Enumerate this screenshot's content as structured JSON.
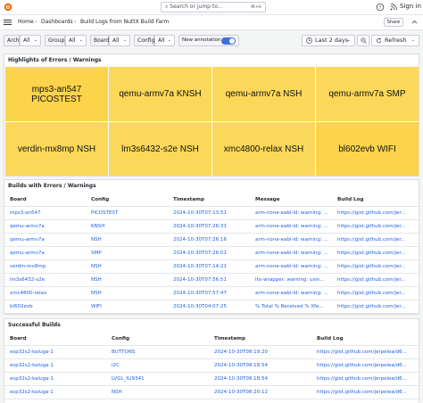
{
  "topbar": {
    "search_placeholder": "Search or jump to...",
    "search_shortcut": "⌘+k",
    "sign_in": "Sign in",
    "icons": [
      "grafana-logo-icon",
      "help-icon",
      "rss-icon",
      "user-icon"
    ]
  },
  "breadcrumb": {
    "items": [
      "Home",
      "Dashboards",
      "Build Logs from NuttX Build Farm"
    ],
    "separator": "›",
    "share": "Share"
  },
  "variables": [
    {
      "label": "Arch",
      "value": "All"
    },
    {
      "label": "Group",
      "value": "All"
    },
    {
      "label": "Board",
      "value": "All"
    },
    {
      "label": "Config",
      "value": "All"
    }
  ],
  "annotation": {
    "label": "New annotation",
    "enabled": true
  },
  "time_range": {
    "label": "Last 2 days"
  },
  "refresh": {
    "label": "Refresh"
  },
  "colors": {
    "stat_bg": "#fbd44c",
    "stat_bg_light": "#fcd85a",
    "link": "#1f62e0",
    "toggle": "#3d71d9"
  },
  "highlights": {
    "title": "Highlights of Errors / Warnings",
    "tiles": [
      "mps3-an547 PICOSTEST",
      "qemu-armv7a KNSH",
      "qemu-armv7a NSH",
      "qemu-armv7a SMP",
      "verdin-mx8mp NSH",
      "lm3s6432-s2e NSH",
      "xmc4800-relax NSH",
      "bl602evb WIFI"
    ]
  },
  "errors": {
    "title": "Builds with Errors / Warnings",
    "columns": [
      "Board",
      "Config",
      "Timestamp",
      "Message",
      "Build Log"
    ],
    "rows": [
      [
        "mps3-an547",
        "PICOSTEST",
        "2024-10-30T07:13:51",
        "arm-none-eabi-ld: warning: ...",
        "https://gist.github.com/jer..."
      ],
      [
        "qemu-armv7a",
        "KNSH",
        "2024-10-30T07:26:31",
        "arm-none-eabi-ld: warning: ...",
        "https://gist.github.com/jer..."
      ],
      [
        "qemu-armv7a",
        "NSH",
        "2024-10-30T07:26:16",
        "arm-none-eabi-ld: warning: ...",
        "https://gist.github.com/jer..."
      ],
      [
        "qemu-armv7a",
        "SMP",
        "2024-10-30T07:26:01",
        "arm-none-eabi-ld: warning: ...",
        "https://gist.github.com/jer..."
      ],
      [
        "verdin-mx8mp",
        "NSH",
        "2024-10-30T07:14:21",
        "arm-none-eabi-ld: warning: ...",
        "https://gist.github.com/jer..."
      ],
      [
        "lm3s6432-s2e",
        "NSH",
        "2024-10-30T07:56:51",
        "lto-wrapper: warning: usin...",
        "https://gist.github.com/jer..."
      ],
      [
        "xmc4800-relax",
        "NSH",
        "2024-10-30T07:57:47",
        "arm-none-eabi-ld: warning: ...",
        "https://gist.github.com/jer..."
      ],
      [
        "bl602evb",
        "WIFI",
        "2024-10-30T04:07:25",
        "% Total % Received % Xfe...",
        "https://gist.github.com/jer..."
      ]
    ]
  },
  "successful": {
    "title": "Successful Builds",
    "columns": [
      "Board",
      "Config",
      "Timestamp",
      "Build Log"
    ],
    "rows": [
      [
        "esp32s2-kaluga-1",
        "BUTTONS",
        "2024-10-30T08:19:20",
        "https://gist.github.com/jerpelea/d6..."
      ],
      [
        "esp32s2-kaluga-1",
        "I2C",
        "2024-10-30T08:18:54",
        "https://gist.github.com/jerpelea/d6..."
      ],
      [
        "esp32s2-kaluga-1",
        "LVGL_ILI9341",
        "2024-10-30T08:18:54",
        "https://gist.github.com/jerpelea/d6..."
      ],
      [
        "esp32s2-kaluga-1",
        "NSH",
        "2024-10-30T08:20:12",
        "https://gist.github.com/jerpelea/d6..."
      ]
    ]
  }
}
